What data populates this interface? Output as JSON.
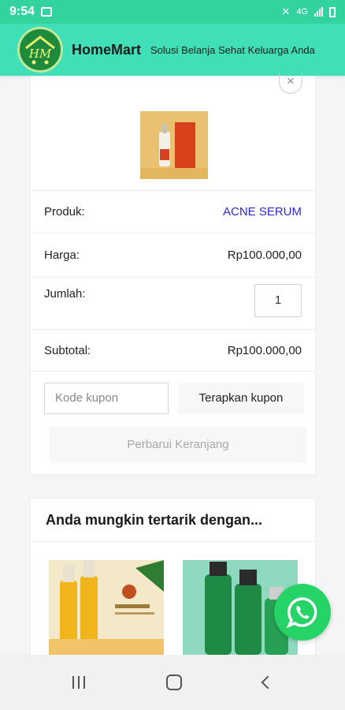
{
  "status_bar": {
    "time": "9:54",
    "network": "4G"
  },
  "header": {
    "logo_text": "HM",
    "brand": "HomeMart",
    "tagline": "Solusi Belanja Sehat Keluarga Anda"
  },
  "cart": {
    "close_label": "×",
    "rows": {
      "produk": {
        "label": "Produk:",
        "value": "ACNE SERUM"
      },
      "harga": {
        "label": "Harga:",
        "value": "Rp100.000,00"
      },
      "jumlah": {
        "label": "Jumlah:",
        "value": "1"
      },
      "subtotal": {
        "label": "Subtotal:",
        "value": "Rp100.000,00"
      }
    },
    "coupon_placeholder": "Kode kupon",
    "apply_label": "Terapkan kupon",
    "update_label": "Perbarui Keranjang"
  },
  "related": {
    "title": "Anda mungkin tertarik dengan..."
  },
  "colors": {
    "header": "#3fe0b8",
    "statusbar": "#33d39f",
    "link": "#2a2ad0",
    "whatsapp": "#25d366"
  }
}
